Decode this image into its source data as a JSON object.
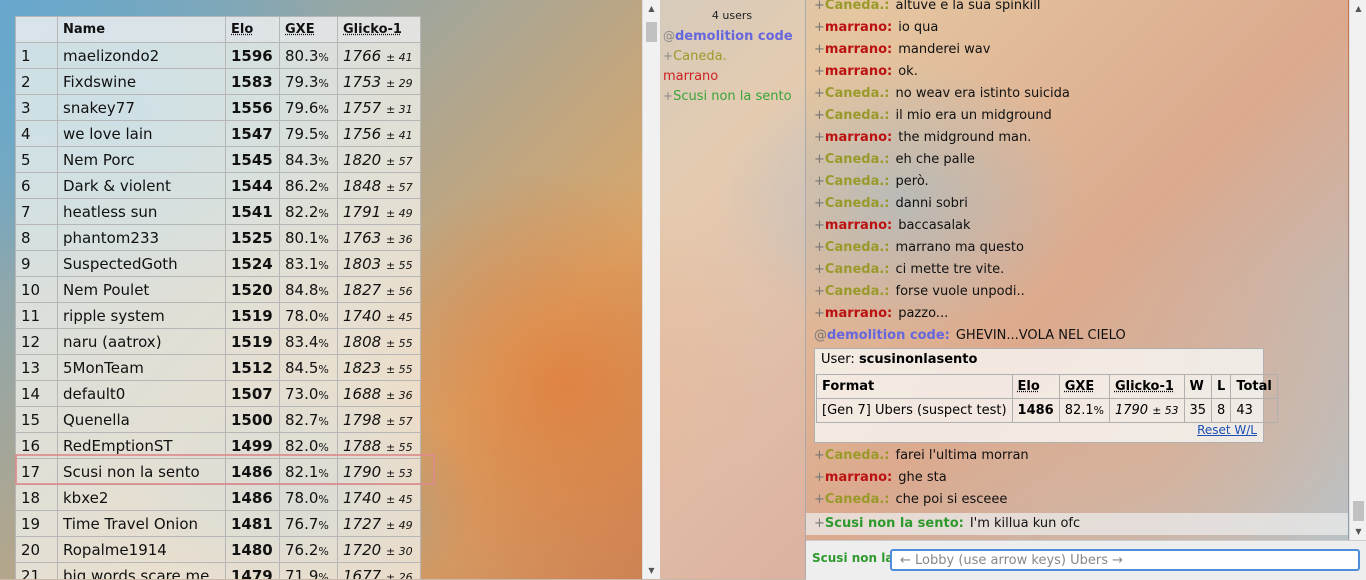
{
  "ladder": {
    "headers": {
      "name": "Name",
      "elo": "Elo",
      "gxe": "GXE",
      "glicko": "Glicko-1"
    },
    "rows": [
      {
        "rank": "1",
        "name": "maelizondo2",
        "elo": "1596",
        "gxe": "80.3",
        "gxe_pct": "%",
        "glicko": "1766",
        "dev": "± 41"
      },
      {
        "rank": "2",
        "name": "Fixdswine",
        "elo": "1583",
        "gxe": "79.3",
        "gxe_pct": "%",
        "glicko": "1753",
        "dev": "± 29"
      },
      {
        "rank": "3",
        "name": "snakey77",
        "elo": "1556",
        "gxe": "79.6",
        "gxe_pct": "%",
        "glicko": "1757",
        "dev": "± 31"
      },
      {
        "rank": "4",
        "name": "we love lain",
        "elo": "1547",
        "gxe": "79.5",
        "gxe_pct": "%",
        "glicko": "1756",
        "dev": "± 41"
      },
      {
        "rank": "5",
        "name": "Nem Porc",
        "elo": "1545",
        "gxe": "84.3",
        "gxe_pct": "%",
        "glicko": "1820",
        "dev": "± 57"
      },
      {
        "rank": "6",
        "name": "Dark & violent",
        "elo": "1544",
        "gxe": "86.2",
        "gxe_pct": "%",
        "glicko": "1848",
        "dev": "± 57"
      },
      {
        "rank": "7",
        "name": "heatless sun",
        "elo": "1541",
        "gxe": "82.2",
        "gxe_pct": "%",
        "glicko": "1791",
        "dev": "± 49"
      },
      {
        "rank": "8",
        "name": "phantom233",
        "elo": "1525",
        "gxe": "80.1",
        "gxe_pct": "%",
        "glicko": "1763",
        "dev": "± 36"
      },
      {
        "rank": "9",
        "name": "SuspectedGoth",
        "elo": "1524",
        "gxe": "83.1",
        "gxe_pct": "%",
        "glicko": "1803",
        "dev": "± 55"
      },
      {
        "rank": "10",
        "name": "Nem Poulet",
        "elo": "1520",
        "gxe": "84.8",
        "gxe_pct": "%",
        "glicko": "1827",
        "dev": "± 56"
      },
      {
        "rank": "11",
        "name": "ripple system",
        "elo": "1519",
        "gxe": "78.0",
        "gxe_pct": "%",
        "glicko": "1740",
        "dev": "± 45"
      },
      {
        "rank": "12",
        "name": "naru (aatrox)",
        "elo": "1519",
        "gxe": "83.4",
        "gxe_pct": "%",
        "glicko": "1808",
        "dev": "± 55"
      },
      {
        "rank": "13",
        "name": "5MonTeam",
        "elo": "1512",
        "gxe": "84.5",
        "gxe_pct": "%",
        "glicko": "1823",
        "dev": "± 55"
      },
      {
        "rank": "14",
        "name": "default0",
        "elo": "1507",
        "gxe": "73.0",
        "gxe_pct": "%",
        "glicko": "1688",
        "dev": "± 36"
      },
      {
        "rank": "15",
        "name": "Quenella",
        "elo": "1500",
        "gxe": "82.7",
        "gxe_pct": "%",
        "glicko": "1798",
        "dev": "± 57"
      },
      {
        "rank": "16",
        "name": "RedEmptionST",
        "elo": "1499",
        "gxe": "82.0",
        "gxe_pct": "%",
        "glicko": "1788",
        "dev": "± 55"
      },
      {
        "rank": "17",
        "name": "Scusi non la sento",
        "elo": "1486",
        "gxe": "82.1",
        "gxe_pct": "%",
        "glicko": "1790",
        "dev": "± 53"
      },
      {
        "rank": "18",
        "name": "kbxe2",
        "elo": "1486",
        "gxe": "78.0",
        "gxe_pct": "%",
        "glicko": "1740",
        "dev": "± 45"
      },
      {
        "rank": "19",
        "name": "Time Travel Onion",
        "elo": "1481",
        "gxe": "76.7",
        "gxe_pct": "%",
        "glicko": "1727",
        "dev": "± 49"
      },
      {
        "rank": "20",
        "name": "Ropalme1914",
        "elo": "1480",
        "gxe": "76.2",
        "gxe_pct": "%",
        "glicko": "1720",
        "dev": "± 30"
      },
      {
        "rank": "21",
        "name": "big words scare me",
        "elo": "1479",
        "gxe": "71.9",
        "gxe_pct": "%",
        "glicko": "1677",
        "dev": "± 26"
      }
    ]
  },
  "userlist": {
    "count": "4 users",
    "users": [
      {
        "group": "@",
        "name": "demolition code"
      },
      {
        "group": "+",
        "name": "Caneda."
      },
      {
        "group": "",
        "name": "marrano"
      },
      {
        "group": "+",
        "name": "Scusi non la sento"
      }
    ]
  },
  "chat": {
    "messages": [
      {
        "group": "+",
        "name": "Caneda.:",
        "text": "altuve e la sua spinkill"
      },
      {
        "group": "+",
        "name": "marrano:",
        "text": "io qua"
      },
      {
        "group": "+",
        "name": "marrano:",
        "text": "manderei wav"
      },
      {
        "group": "+",
        "name": "marrano:",
        "text": "ok."
      },
      {
        "group": "+",
        "name": "Caneda.:",
        "text": "no weav era istinto suicida"
      },
      {
        "group": "+",
        "name": "Caneda.:",
        "text": "il mio era un midground"
      },
      {
        "group": "+",
        "name": "marrano:",
        "text": "the midground man."
      },
      {
        "group": "+",
        "name": "Caneda.:",
        "text": "eh che palle"
      },
      {
        "group": "+",
        "name": "Caneda.:",
        "text": "però."
      },
      {
        "group": "+",
        "name": "Caneda.:",
        "text": "danni sobri"
      },
      {
        "group": "+",
        "name": "marrano:",
        "text": "baccasalak"
      },
      {
        "group": "+",
        "name": "Caneda.:",
        "text": "marrano ma questo"
      },
      {
        "group": "+",
        "name": "Caneda.:",
        "text": "ci mette tre vite."
      },
      {
        "group": "+",
        "name": "Caneda.:",
        "text": "forse vuole unpodi.."
      },
      {
        "group": "+",
        "name": "marrano:",
        "text": "pazzo..."
      },
      {
        "group": "@",
        "name": "demolition code:",
        "text": "GHEVIN...VOLA NEL CIELO"
      }
    ],
    "card": {
      "user_label": "User:",
      "user_name": "scusinonlasento",
      "headers": {
        "format": "Format",
        "elo": "Elo",
        "gxe": "GXE",
        "glicko": "Glicko-1",
        "w": "W",
        "l": "L",
        "total": "Total"
      },
      "row": {
        "format": "[Gen 7] Ubers (suspect test)",
        "elo": "1486",
        "gxe": "82.1",
        "gxe_pct": "%",
        "glicko": "1790",
        "dev": "± 53",
        "w": "35",
        "l": "8",
        "total": "43"
      },
      "reset": "Reset W/L"
    },
    "messages2": [
      {
        "group": "+",
        "name": "Caneda.:",
        "text": "farei l'ultima morran"
      },
      {
        "group": "+",
        "name": "marrano:",
        "text": "ghe sta"
      },
      {
        "group": "+",
        "name": "Caneda.:",
        "text": "che poi si esceee"
      },
      {
        "group": "+",
        "name": "Scusi non la sento:",
        "text": "I'm killua kun ofc"
      }
    ]
  },
  "chatbar": {
    "label": "Scusi non la",
    "placeholder": "← Lobby (use arrow keys) Ubers →"
  }
}
